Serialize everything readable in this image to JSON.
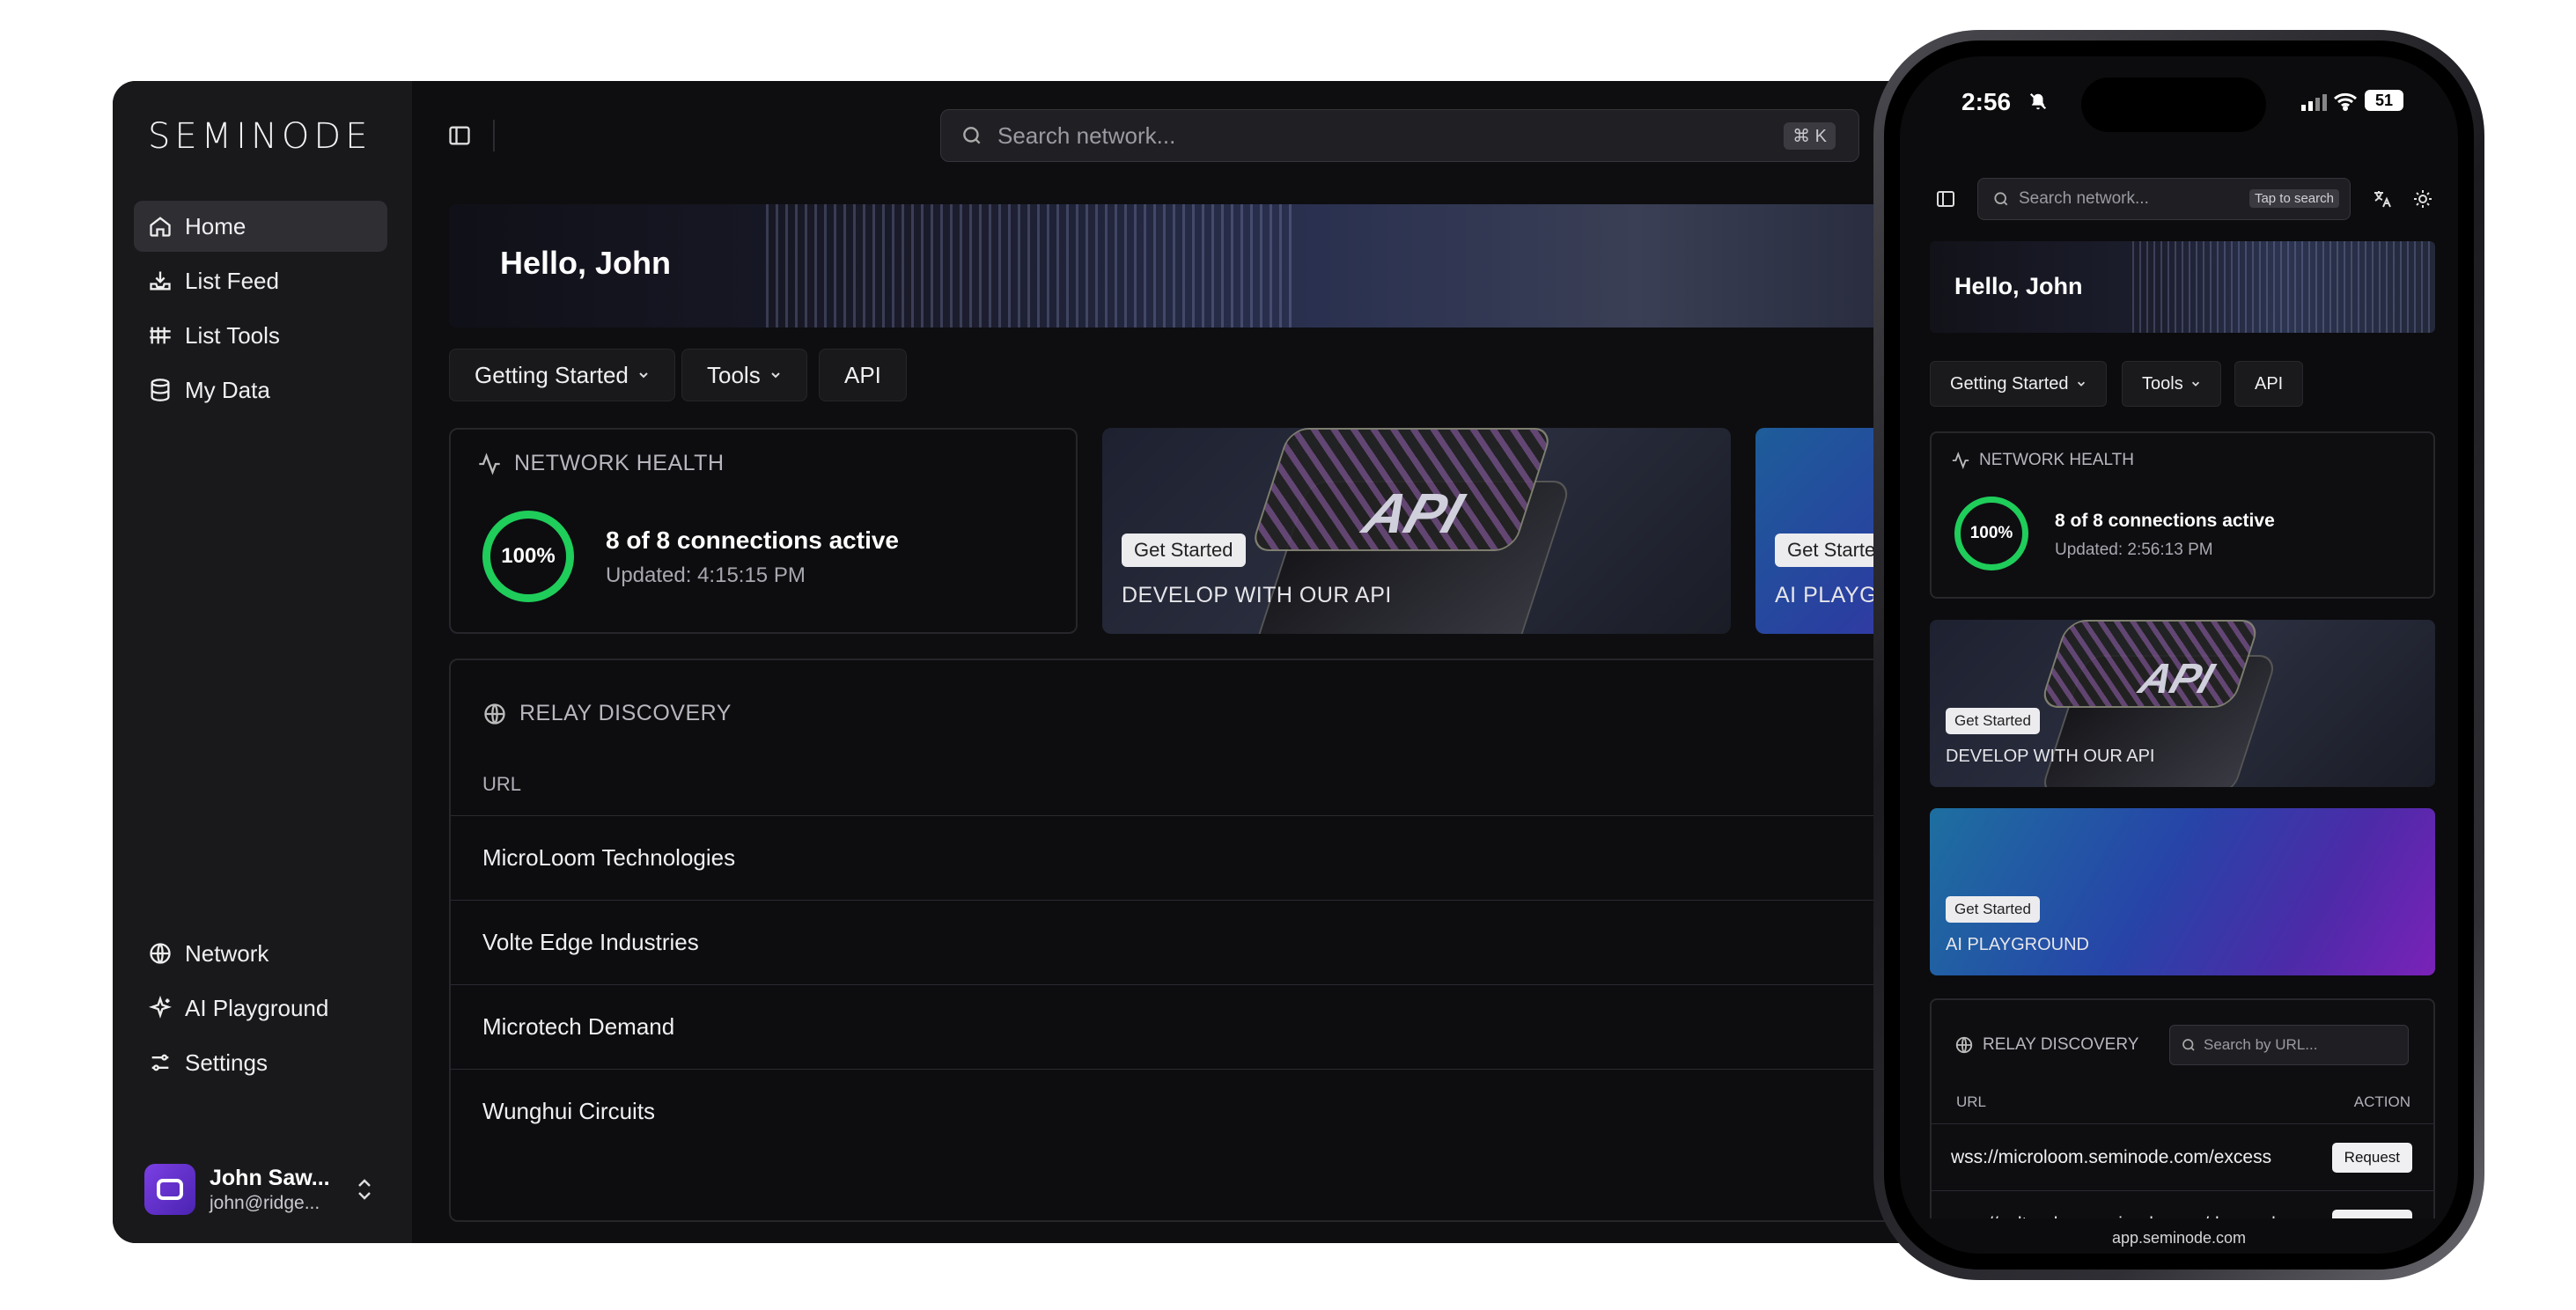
{
  "desktop": {
    "logo": "SEMINODE",
    "nav_top": [
      {
        "label": "Home",
        "icon": "home-icon"
      },
      {
        "label": "List Feed",
        "icon": "inbox-icon"
      },
      {
        "label": "List Tools",
        "icon": "grid-icon"
      },
      {
        "label": "My Data",
        "icon": "database-icon"
      }
    ],
    "nav_bottom": [
      {
        "label": "Network",
        "icon": "globe-icon"
      },
      {
        "label": "AI Playground",
        "icon": "sparkles-icon"
      },
      {
        "label": "Settings",
        "icon": "sliders-icon"
      }
    ],
    "user": {
      "name": "John Saw...",
      "email": "john@ridge..."
    },
    "search": {
      "placeholder": "Search network...",
      "shortcut": "⌘ K"
    },
    "greeting": "Hello, John",
    "tabs": [
      {
        "label": "Getting Started",
        "dropdown": true
      },
      {
        "label": "Tools",
        "dropdown": true
      },
      {
        "label": "API",
        "dropdown": false
      }
    ],
    "health": {
      "title": "NETWORK HEALTH",
      "percent": "100%",
      "percent_value": 100,
      "status": "8 of 8 connections active",
      "updated": "Updated: 4:15:15 PM"
    },
    "promos": [
      {
        "button": "Get Started",
        "title": "DEVELOP WITH OUR API"
      },
      {
        "button": "Get Started",
        "title": "AI PLAYGROUND"
      }
    ],
    "relay": {
      "title": "RELAY DISCOVERY",
      "column": "URL",
      "rows": [
        "MicroLoom Technologies",
        "Volte Edge Industries",
        "Microtech Demand",
        "Wunghui Circuits"
      ]
    }
  },
  "phone": {
    "time": "2:56",
    "battery": "51",
    "search": {
      "placeholder": "Search network...",
      "hint": "Tap to search"
    },
    "greeting": "Hello, John",
    "tabs": [
      {
        "label": "Getting Started"
      },
      {
        "label": "Tools"
      },
      {
        "label": "API"
      }
    ],
    "health": {
      "title": "NETWORK HEALTH",
      "percent": "100%",
      "status": "8 of 8 connections active",
      "updated": "Updated: 2:56:13 PM"
    },
    "promos": [
      {
        "button": "Get Started",
        "title": "DEVELOP WITH OUR API"
      },
      {
        "button": "Get Started",
        "title": "AI PLAYGROUND"
      }
    ],
    "relay": {
      "title": "RELAY DISCOVERY",
      "search_placeholder": "Search by URL...",
      "col_url": "URL",
      "col_action": "ACTION",
      "rows": [
        {
          "url": "wss://microloom.seminode.com/excess",
          "action": "Request"
        },
        {
          "url": "wss://volteedge.seminode.com/demand",
          "action": "Request"
        }
      ]
    },
    "url_bar": "app.seminode.com"
  },
  "colors": {
    "accent_green": "#1fcd5a",
    "avatar_purple": "#7b3fe4",
    "background": "#0e0e10"
  }
}
